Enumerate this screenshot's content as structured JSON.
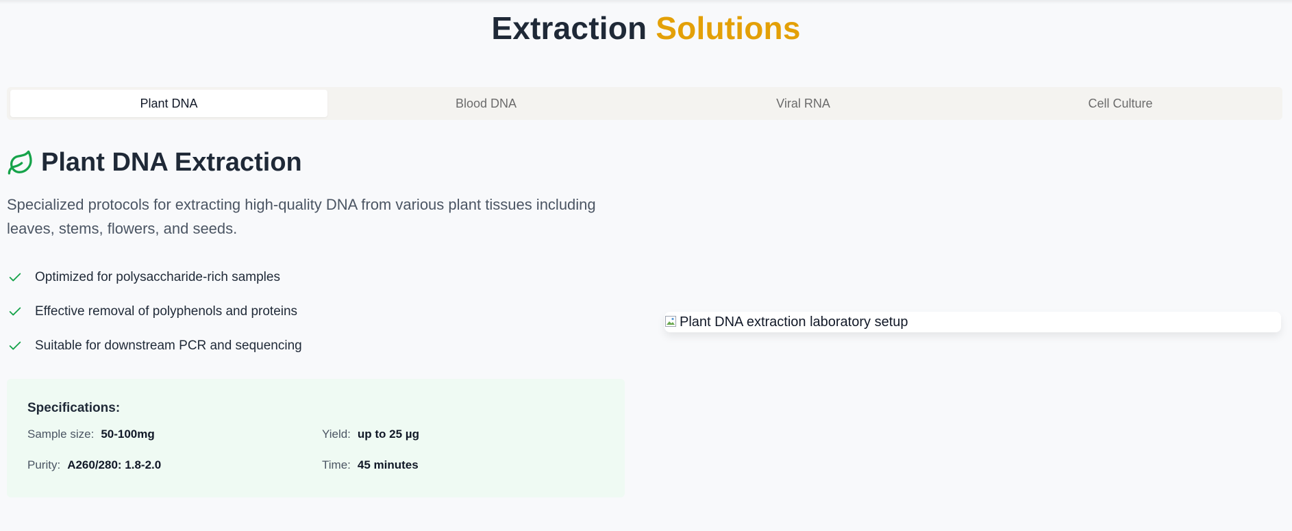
{
  "header": {
    "title_part1": "Extraction",
    "title_part2": "Solutions",
    "accent_color": "#e3a007"
  },
  "tabs": [
    {
      "label": "Plant DNA",
      "active": true
    },
    {
      "label": "Blood DNA",
      "active": false
    },
    {
      "label": "Viral RNA",
      "active": false
    },
    {
      "label": "Cell Culture",
      "active": false
    }
  ],
  "section": {
    "icon": "leaf-icon",
    "icon_color": "#16a34a",
    "title": "Plant DNA Extraction",
    "description": "Specialized protocols for extracting high-quality DNA from various plant tissues including leaves, stems, flowers, and seeds."
  },
  "features": [
    "Optimized for polysaccharide-rich samples",
    "Effective removal of polyphenols and proteins",
    "Suitable for downstream PCR and sequencing"
  ],
  "specs": {
    "heading": "Specifications:",
    "sample_size_label": "Sample size:",
    "sample_size_value": "50-100mg",
    "yield_label": "Yield:",
    "yield_value": "up to 25 µg",
    "purity_label": "Purity:",
    "purity_value": "A260/280: 1.8-2.0",
    "time_label": "Time:",
    "time_value": "45 minutes",
    "background_color": "#effaf3"
  },
  "image": {
    "alt": "Plant DNA extraction laboratory setup",
    "icon": "broken-image-icon"
  }
}
